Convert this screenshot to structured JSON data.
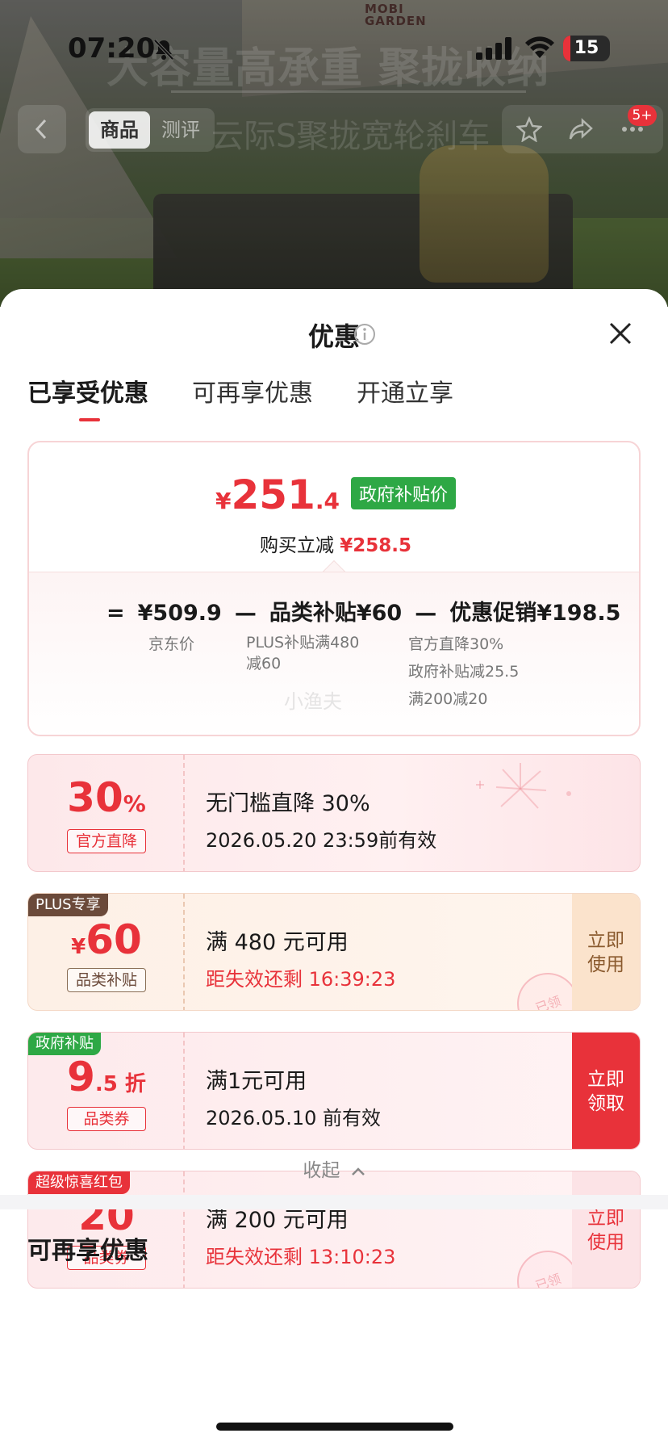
{
  "status_bar": {
    "time": "07:20",
    "battery": "15"
  },
  "hero": {
    "brand": "MOBI\nGARDEN",
    "overlay_title": "大容量高承重 聚拢收纳",
    "overlay_sub": "云际S聚拢宽轮刹车"
  },
  "nav": {
    "tabs": [
      {
        "label": "商品",
        "active": true
      },
      {
        "label": "测评",
        "active": false
      }
    ],
    "badge": "5+"
  },
  "sheet": {
    "title": "优惠",
    "tabs": [
      {
        "label": "已享受优惠",
        "active": true
      },
      {
        "label": "可再享优惠",
        "active": false
      },
      {
        "label": "开通立享",
        "active": false
      }
    ],
    "summary": {
      "price_currency": "¥",
      "price_int": "251",
      "price_dec": ".4",
      "price_tag": "政府补贴价",
      "save_label": "购买立减",
      "save_amount": "¥258.5",
      "equation": {
        "eq": "=",
        "base": "¥509.9",
        "minus1": "—",
        "cat": "品类补贴¥60",
        "minus2": "—",
        "promo": "优惠促销¥198.5"
      },
      "notes": {
        "base": [
          "京东价"
        ],
        "cat": [
          "PLUS补贴满480",
          "减60"
        ],
        "promo": [
          "官方直降30%",
          "政府补贴减25.5",
          "满200减20"
        ]
      },
      "watermark": "小渔夫"
    },
    "coupons": [
      {
        "value_main": "30",
        "value_suffix": "%",
        "sub": "官方直降",
        "line1": "无门槛直降 30%",
        "line2": "2026.05.20 23:59前有效",
        "line2_red": false
      },
      {
        "corner": "PLUS专享",
        "value_prefix": "¥",
        "value_main": "60",
        "sub": "品类补贴",
        "line1": "满 480 元可用",
        "line2": "距失效还剩 16:39:23",
        "line2_red": true,
        "action": "立即\n使用",
        "stamp": "已领"
      },
      {
        "corner": "政府补贴",
        "value_main": "9",
        "value_suffix": ".5 折",
        "sub": "品类券",
        "line1": "满1元可用",
        "line2": "2026.05.10 前有效",
        "line2_red": false,
        "action": "立即\n领取"
      },
      {
        "corner": "超级惊喜红包",
        "value_main": "20",
        "sub": "品类券",
        "line1": "满 200 元可用",
        "line2": "距失效还剩 13:10:23",
        "line2_red": true,
        "action": "立即\n使用",
        "stamp": "已领"
      }
    ],
    "collapse_label": "收起",
    "more_title": "可再享优惠"
  },
  "colors": {
    "accent": "#e8323a",
    "gov_green": "#2ea845",
    "plus_brown": "#6b4a3a"
  }
}
